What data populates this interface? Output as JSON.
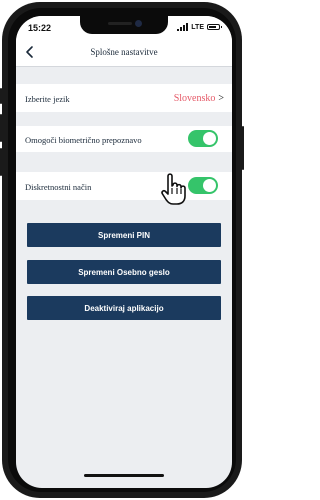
{
  "status": {
    "time": "15:22",
    "network": "LTE"
  },
  "nav": {
    "title": "Splošne nastavitve"
  },
  "settings": {
    "language_label": "Izberite jezik",
    "language_value": "Slovensko",
    "language_arrow": ">",
    "biometric_label": "Omogoči biometrično prepoznavo",
    "biometric_enabled": true,
    "discreet_label": "Diskretnostni način",
    "discreet_enabled": true
  },
  "actions": {
    "change_pin": "Spremeni PIN",
    "change_password": "Spremeni Osebno geslo",
    "deactivate": "Deaktiviraj aplikacijo"
  },
  "colors": {
    "accent": "#e55a68",
    "toggle_on": "#35c46a",
    "button_bg": "#1b3a5e",
    "screen_bg": "#eceef1"
  }
}
